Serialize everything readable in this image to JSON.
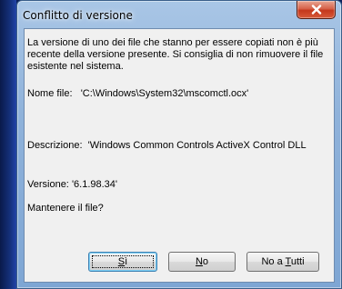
{
  "dialog": {
    "title": "Conflitto di versione",
    "close_icon": "close-icon",
    "message_lines": [
      "La versione di uno dei file che stanno per essere copiati non è più",
      "recente della versione presente. Si consiglia di non rimuovere il file",
      "esistente nel sistema."
    ],
    "file_name_label": "Nome file:",
    "file_name_value": "'C:\\Windows\\System32\\mscomctl.ocx'",
    "description_label": "Descrizione:",
    "description_value": "'Windows Common Controls ActiveX Control DLL",
    "version_label": "Versione:",
    "version_value": "'6.1.98.34'",
    "question": "Mantenere il file?",
    "buttons": {
      "yes": {
        "label": "Sì",
        "accesskey": "S",
        "rest": "ì"
      },
      "no": {
        "label": "No",
        "accesskey": "N",
        "rest": "o"
      },
      "no_all": {
        "label": "No a Tutti",
        "prefix": "No a ",
        "accesskey": "T",
        "rest": "utti"
      }
    }
  },
  "colors": {
    "close_button": "#c4371c",
    "window_frame": "#8fb2da",
    "content_bg": "#f0f0f0"
  }
}
